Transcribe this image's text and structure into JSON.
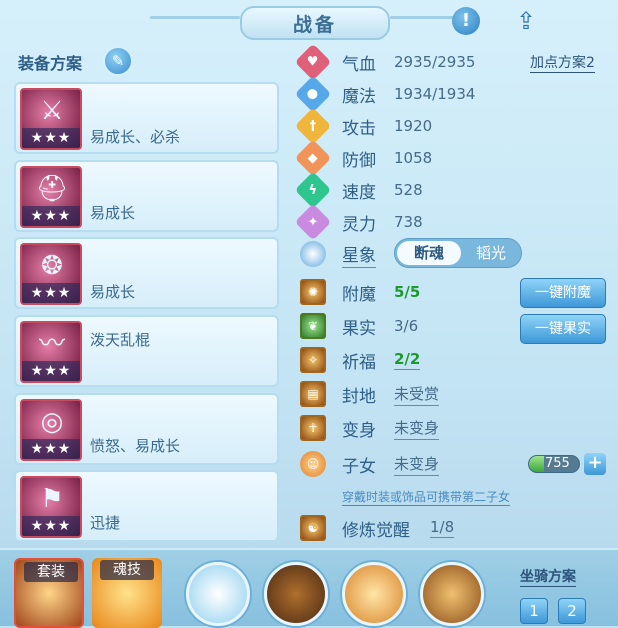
{
  "title": "战备",
  "left": {
    "heading": "装备方案",
    "items": [
      {
        "label": "易成长、必杀",
        "stars": "★★★",
        "icon": "sword-icon"
      },
      {
        "label": "易成长",
        "stars": "★★★",
        "icon": "helmet-icon"
      },
      {
        "label": "易成长",
        "stars": "★★★",
        "icon": "necklace-icon"
      },
      {
        "label": "泼天乱棍",
        "stars": "★★★",
        "icon": "staff-icon"
      },
      {
        "label": "愤怒、易成长",
        "stars": "★★★",
        "icon": "belt-icon"
      },
      {
        "label": "迅捷",
        "stars": "★★★",
        "icon": "boots-icon"
      }
    ]
  },
  "stats": {
    "plan_link": "加点方案2",
    "hp_label": "气血",
    "hp_value": "2935/2935",
    "mp_label": "魔法",
    "mp_value": "1934/1934",
    "atk_label": "攻击",
    "atk_value": "1920",
    "def_label": "防御",
    "def_value": "1058",
    "spd_label": "速度",
    "spd_value": "528",
    "spi_label": "灵力",
    "spi_value": "738",
    "star_label": "星象",
    "star_on": "断魂",
    "star_off": "韬光"
  },
  "extras": {
    "enchant_label": "附魔",
    "enchant_value": "5/5",
    "enchant_btn": "一键附魔",
    "fruit_label": "果实",
    "fruit_value": "3/6",
    "fruit_btn": "一键果实",
    "bless_label": "祈福",
    "bless_value": "2/2",
    "land_label": "封地",
    "land_value": "未受赏",
    "transform_label": "变身",
    "transform_value": "未变身",
    "child_label": "子女",
    "child_value": "未变身",
    "child_exp": "755",
    "child_exp_fraction": 0.3,
    "hint": "穿戴时装或饰品可携带第二子女",
    "cultivate_label": "修炼觉醒",
    "cultivate_value": "1/8"
  },
  "bottom": {
    "tab_set": "套装",
    "tab_skill": "魂技",
    "mount_title": "坐骑方案",
    "mount_1": "1",
    "mount_2": "2"
  }
}
